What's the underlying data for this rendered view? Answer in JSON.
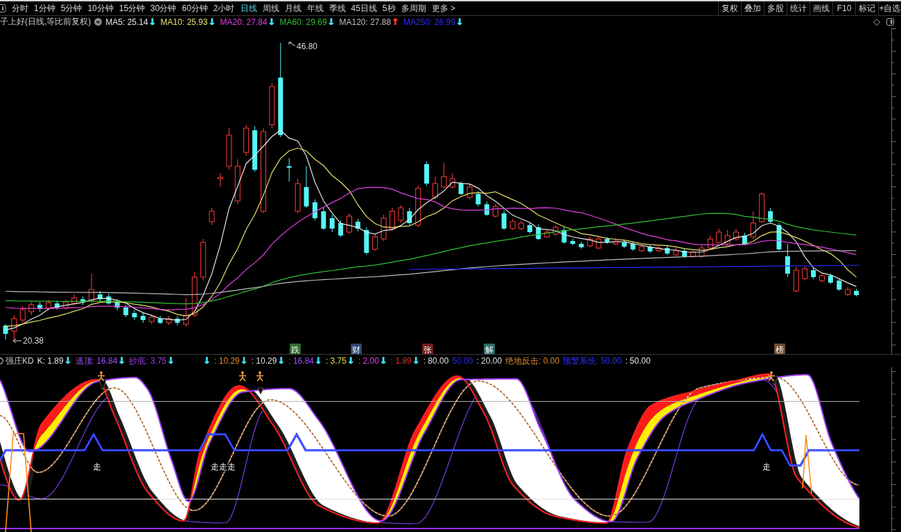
{
  "toolbar": {
    "periods": [
      {
        "label": "分时",
        "selected": false
      },
      {
        "label": "1分钟",
        "selected": false
      },
      {
        "label": "5分钟",
        "selected": false
      },
      {
        "label": "10分钟",
        "selected": false
      },
      {
        "label": "15分钟",
        "selected": false
      },
      {
        "label": "30分钟",
        "selected": false
      },
      {
        "label": "60分钟",
        "selected": false
      },
      {
        "label": "2小时",
        "selected": false
      },
      {
        "label": "日线",
        "selected": true
      },
      {
        "label": "周线",
        "selected": false
      },
      {
        "label": "月线",
        "selected": false
      },
      {
        "label": "年线",
        "selected": false
      },
      {
        "label": "季线",
        "selected": false
      },
      {
        "label": "45日线",
        "selected": false
      },
      {
        "label": "5秒",
        "selected": false
      },
      {
        "label": "多周期",
        "selected": false
      },
      {
        "label": "更多 >",
        "selected": false
      }
    ],
    "actions": [
      "复权",
      "叠加",
      "多股",
      "统计",
      "画线",
      "F10",
      "标记",
      "+自选"
    ]
  },
  "chart_header": {
    "title": "子上好(日线,等比前复权)",
    "moving_averages": [
      {
        "label": "MA5: 25.14",
        "arrow": {
          "symbol": "↓",
          "color": "#40e0f0"
        },
        "color": "#e6e6e6"
      },
      {
        "label": "MA10: 25.93",
        "arrow": {
          "symbol": "↓",
          "color": "#40e0f0"
        },
        "color": "#e8e070"
      },
      {
        "label": "MA20: 27.84",
        "arrow": {
          "symbol": "↓",
          "color": "#40e0f0"
        },
        "color": "#e040e0"
      },
      {
        "label": "MA60: 29.69",
        "arrow": {
          "symbol": "↓",
          "color": "#40e0f0"
        },
        "color": "#30c030"
      },
      {
        "label": "MA120: 27.88",
        "arrow": {
          "symbol": "↑",
          "color": "#ff3030"
        },
        "color": "#bcbcbc"
      },
      {
        "label": "MA250: 26.99",
        "arrow": {
          "symbol": "↓",
          "color": "#40e0f0"
        },
        "color": "#2a2aff"
      }
    ]
  },
  "main_chart": {
    "high_label": "46.80",
    "low_label": "20.38",
    "signals": [
      {
        "label": "跌",
        "color": "#2f6e2f"
      },
      {
        "label": "财",
        "color": "#2c4470"
      },
      {
        "label": "张",
        "color": "#701c1c"
      },
      {
        "label": "解",
        "color": "#2a6a6a"
      },
      {
        "label": "榜",
        "color": "#6e4a30"
      }
    ]
  },
  "indicator": {
    "title": "强庄KD",
    "values": [
      {
        "label": "K: 1.89",
        "arrow": {
          "symbol": "↓",
          "color": "#40e0f0"
        },
        "color": "#e0e0e0"
      },
      {
        "label": "逃顶: 16.84",
        "arrow": {
          "symbol": "↓",
          "color": "#40e0f0"
        },
        "color": "#a050ff"
      },
      {
        "label": "抄底: 3.75",
        "arrow": {
          "symbol": "↓",
          "color": "#40e0f0"
        },
        "color": "#9a40e0"
      },
      {
        "arrow": {
          "symbol": "↓",
          "color": "#40e0f0"
        }
      },
      {
        "label": ": 10.29",
        "arrow": {
          "symbol": "↓",
          "color": "#40e0f0"
        },
        "color": "#e08a30"
      },
      {
        "label": ": 10.29",
        "arrow": {
          "symbol": "↓",
          "color": "#40e0f0"
        },
        "color": "#e0e0e0"
      },
      {
        "label": ": 16.84",
        "arrow": {
          "symbol": "↓",
          "color": "#40e0f0"
        },
        "color": "#a050ff"
      },
      {
        "label": ": 3.75",
        "arrow": {
          "symbol": "↓",
          "color": "#40e0f0"
        },
        "color": "#e0e040"
      },
      {
        "label": ": 2.00",
        "arrow": {
          "symbol": "↓",
          "color": "#40e0f0"
        },
        "color": "#e040e0"
      },
      {
        "label": ": 1.89",
        "arrow": {
          "symbol": "↓",
          "color": "#40e0f0"
        },
        "color": "#e03030"
      },
      {
        "label": ": 80.00",
        "color": "#e0e0e0"
      },
      {
        "label": "50.00",
        "color": "#2a2aff"
      },
      {
        "label": ": 20.00",
        "color": "#e0e0e0"
      },
      {
        "label": "绝地反击: 0.00",
        "color": "#e08a30"
      },
      {
        "label": "预警系统: 50.00",
        "color": "#3030ff"
      },
      {
        "label": ": 50.00",
        "color": "#e0e0e0"
      }
    ],
    "walk_labels": [
      "走",
      "走走走",
      "走"
    ]
  }
}
